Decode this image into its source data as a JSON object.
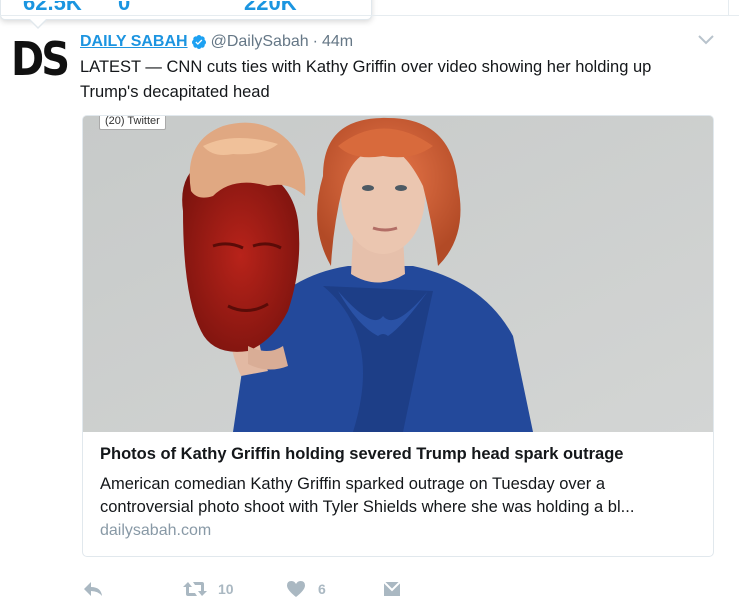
{
  "hovercard": {
    "stat1": "62.5K",
    "stat2": "0",
    "stat3": "220K"
  },
  "tweet": {
    "name": "DAILY SABAH",
    "handle": "@DailySabah",
    "separator": "·",
    "time": "44m",
    "text": "LATEST — CNN cuts ties with Kathy Griffin over video showing her holding up Trump's decapitated head",
    "avatar_text": "DS"
  },
  "card": {
    "badge": "(20) Twitter",
    "title": "Photos of Kathy Griffin holding severed Trump head spark outrage",
    "description": "American comedian Kathy Griffin sparked outrage on Tuesday over a controversial photo shoot with Tyler Shields where she was holding a bl...",
    "domain": "dailysabah.com"
  },
  "actions": {
    "retweets": "10",
    "likes": "6"
  },
  "colors": {
    "accent": "#1c94e0",
    "muted": "#657786",
    "action_icon": "#aab8c2"
  }
}
